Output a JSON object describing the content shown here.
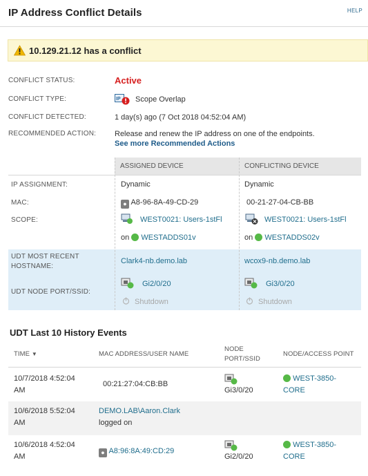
{
  "header": {
    "title": "IP Address Conflict Details",
    "help": "HELP"
  },
  "alert": {
    "message": "10.129.21.12 has a conflict",
    "icon": "warning-icon"
  },
  "details": {
    "status_label": "CONFLICT STATUS:",
    "status_value": "Active",
    "type_label": "CONFLICT TYPE:",
    "type_value": "Scope Overlap",
    "detected_label": "CONFLICT DETECTED:",
    "detected_value": "1 day(s) ago (7 Oct 2018 04:52:04 AM)",
    "action_label": "RECOMMENDED ACTION:",
    "action_value": "Release and renew the IP address on one of the endpoints.",
    "action_link": "See more Recommended Actions"
  },
  "devices": {
    "assigned_header": "ASSIGNED DEVICE",
    "conflicting_header": "CONFLICTING DEVICE",
    "ip_assignment_label": "IP ASSIGNMENT:",
    "mac_label": "MAC:",
    "scope_label": "SCOPE:",
    "hostname_label": "UDT MOST RECENT HOSTNAME:",
    "port_label": "UDT NODE PORT/SSID:",
    "on_label": "on",
    "assigned": {
      "ip_assignment": "Dynamic",
      "mac": "A8-96-8A-49-CD-29",
      "scope": "WEST0021: Users-1stFl",
      "server": "WESTADDS01v",
      "hostname": "Clark4-nb.demo.lab",
      "port": "Gi2/0/20",
      "port_state": "Shutdown"
    },
    "conflicting": {
      "ip_assignment": "Dynamic",
      "mac": "00-21-27-04-CB-BB",
      "scope": "WEST0021: Users-1stFl",
      "server": "WESTADDS02v",
      "hostname": "wcox9-nb.demo.lab",
      "port": "Gi3/0/20",
      "port_state": "Shutdown"
    }
  },
  "history": {
    "title": "UDT Last 10 History Events",
    "columns": {
      "time": "TIME",
      "mac": "MAC ADDRESS/USER NAME",
      "node_port_1": "NODE",
      "node_port_2": "PORT/SSID",
      "access_point": "NODE/ACCESS POINT"
    },
    "rows": [
      {
        "time_1": "10/7/2018 4:52:04",
        "time_2": "AM",
        "mac": "00:21:27:04:CB:BB",
        "port": "Gi3/0/20",
        "ap_1": "WEST-3850-",
        "ap_2": "CORE"
      },
      {
        "time_1": "10/6/2018 5:52:04",
        "time_2": "AM",
        "user_1": "DEMO.LAB\\Aaron.Clark",
        "user_2": "logged on"
      },
      {
        "time_1": "10/6/2018 4:52:04",
        "time_2": "AM",
        "mac": "A8:96:8A:49:CD:29",
        "port": "Gi2/0/20",
        "ap_1": "WEST-3850-",
        "ap_2": "CORE"
      }
    ]
  },
  "colors": {
    "accent": "#1f6d8c",
    "active": "#d62020",
    "status_up": "#56b947",
    "alert_bg": "#fcf7d3",
    "udt_bg": "#dfeef8"
  }
}
